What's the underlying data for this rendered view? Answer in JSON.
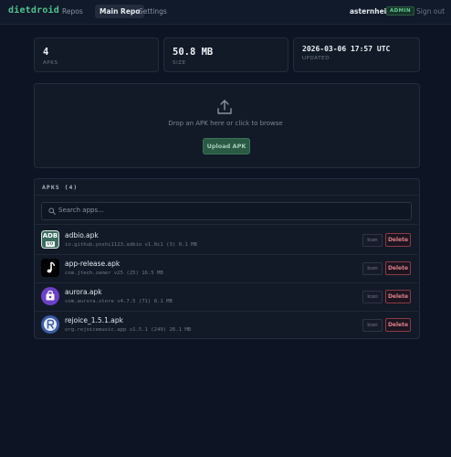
{
  "nav": {
    "brand": "dietdroid",
    "links": [
      {
        "label": "Repos"
      },
      {
        "label": "Main Repo",
        "active": true
      },
      {
        "label": "Settings"
      }
    ],
    "user": "asternheim",
    "role_badge": "ADMIN",
    "sign_out": "Sign out"
  },
  "stats": [
    {
      "value": "4",
      "label": "APKS"
    },
    {
      "value": "50.8 MB",
      "label": "SIZE"
    },
    {
      "value": "2026-03-06 17:57 UTC",
      "label": "UPDATED"
    }
  ],
  "dropzone": {
    "text": "Drop an APK here or click to browse",
    "button": "Upload APK",
    "icon": "upload-icon"
  },
  "apks": {
    "title": "APKS (4)",
    "search_placeholder": "Search apps...",
    "icon_button": "Icon",
    "delete_button": "Delete",
    "items": [
      {
        "name": "adbio.apk",
        "meta": "io.github.yoshi1123.adbio v1.0c1 (3) 0.1 MB",
        "icon": "adb-icon"
      },
      {
        "name": "app-release.apk",
        "meta": "com.jtech.zemer v25 (25) 16.5 MB",
        "icon": "music-note-icon"
      },
      {
        "name": "aurora.apk",
        "meta": "com.aurora.store v4.7.5 (71) 8.1 MB",
        "icon": "aurora-store-icon"
      },
      {
        "name": "rejoice_1.5.1.apk",
        "meta": "org.rejoicemusic.app v1.5.1 (249) 26.1 MB",
        "icon": "rejoice-icon"
      }
    ]
  },
  "colors": {
    "background": "#0d1524",
    "brand": "#4fc28e",
    "danger": "#e07f8a",
    "upload_button": "#2a5a43"
  }
}
